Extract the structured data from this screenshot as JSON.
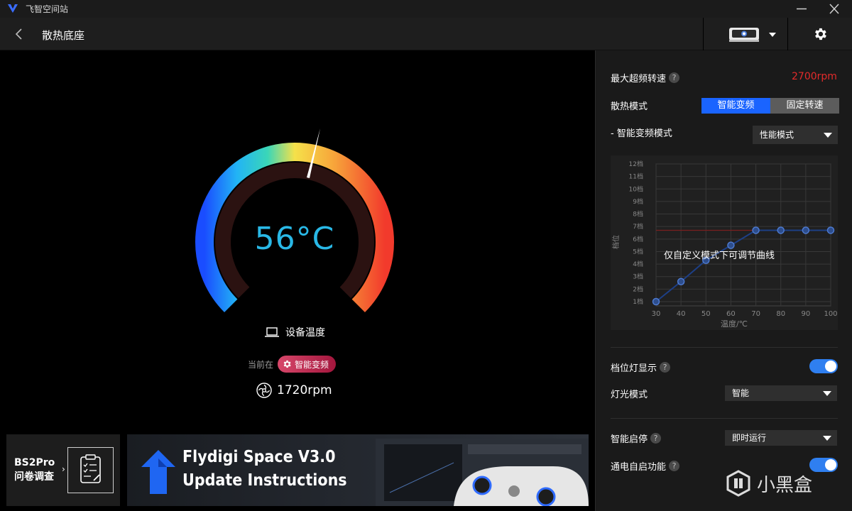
{
  "app": {
    "title": "飞智空间站"
  },
  "header": {
    "title": "散热底座"
  },
  "gauge": {
    "temperature": "56°C",
    "device_label": "设备温度",
    "current_prefix": "当前在",
    "current_mode": "智能变频",
    "rpm": "1720rpm",
    "colors": {
      "temp_text": "#29b8e6",
      "arc_start": "#1a4dff",
      "arc_mid": "#f5e14a",
      "arc_end": "#f23a2c"
    }
  },
  "survey": {
    "line1": "BS2Pro",
    "line2": "问卷调查",
    "arrow": "›"
  },
  "banner": {
    "line1": "Flydigi Space V3.0",
    "line2": "Update Instructions"
  },
  "settings": {
    "max_rpm_label": "最大超频转速",
    "max_rpm_value": "2700rpm",
    "cooling_mode_label": "散热模式",
    "mode_options": [
      "智能变频",
      "固定转速"
    ],
    "smart_mode_label": "- 智能变频模式",
    "smart_mode_value": "性能模式",
    "gear_light_label": "档位灯显示",
    "light_mode_label": "灯光模式",
    "light_mode_value": "智能",
    "smart_start_label": "智能启停",
    "smart_start_value": "即时运行",
    "power_on_label": "通电自启功能",
    "help": "?",
    "accent_color": "#1a64ff",
    "max_rpm_color": "#e32b2b"
  },
  "chart_data": {
    "type": "line",
    "xlabel": "温度/℃",
    "ylabel": "档位",
    "x": [
      30,
      40,
      50,
      60,
      70,
      80,
      90,
      100
    ],
    "y_ticks": [
      "1档",
      "2档",
      "3档",
      "4档",
      "5档",
      "6档",
      "7档",
      "8档",
      "9档",
      "10档",
      "11档",
      "12档"
    ],
    "series": [
      {
        "values": [
          1,
          2.6,
          4.3,
          5.5,
          6.7,
          6.7,
          6.7,
          6.7
        ]
      }
    ],
    "reference_line": 6.7,
    "xlim": [
      30,
      100
    ],
    "ylim": [
      1,
      12
    ],
    "grid": true,
    "annotation": "仅自定义模式下可调节曲线"
  },
  "watermark": {
    "text": "小黑盒"
  }
}
